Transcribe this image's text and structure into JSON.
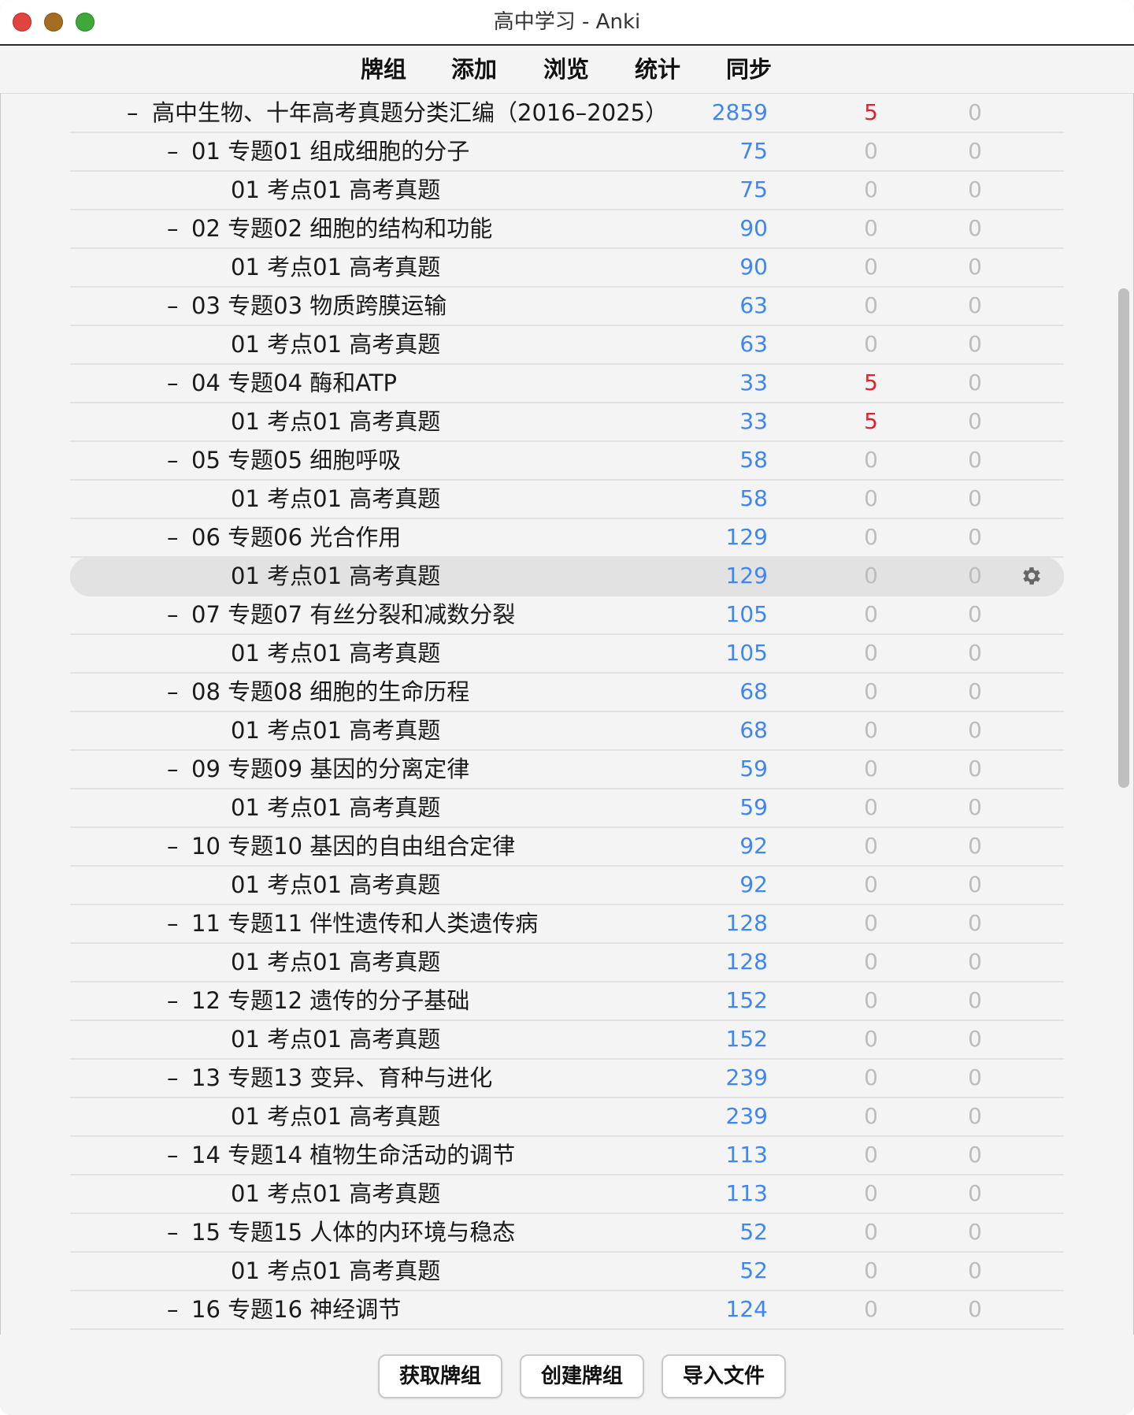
{
  "window": {
    "title": "高中学习 - Anki"
  },
  "toolbar": {
    "decks": "牌组",
    "add": "添加",
    "browse": "浏览",
    "stats": "统计",
    "sync": "同步"
  },
  "colors": {
    "new": "#3f86ef",
    "learn": "#e0212e",
    "zero": "#bdbdbd",
    "selected_row": "#e2e2e2"
  },
  "decks": [
    {
      "collapse": "–",
      "name": "高中生物、十年高考真题分类汇编（2016–2025）",
      "new": "2859",
      "learn": "5",
      "due": "0",
      "level": 0
    },
    {
      "collapse": "–",
      "name": "01 专题01 组成细胞的分子",
      "new": "75",
      "learn": "0",
      "due": "0",
      "level": 1
    },
    {
      "collapse": "",
      "name": "01 考点01 高考真题",
      "new": "75",
      "learn": "0",
      "due": "0",
      "level": 2
    },
    {
      "collapse": "–",
      "name": "02 专题02 细胞的结构和功能",
      "new": "90",
      "learn": "0",
      "due": "0",
      "level": 1
    },
    {
      "collapse": "",
      "name": "01 考点01 高考真题",
      "new": "90",
      "learn": "0",
      "due": "0",
      "level": 2
    },
    {
      "collapse": "–",
      "name": "03 专题03 物质跨膜运输",
      "new": "63",
      "learn": "0",
      "due": "0",
      "level": 1
    },
    {
      "collapse": "",
      "name": "01 考点01 高考真题",
      "new": "63",
      "learn": "0",
      "due": "0",
      "level": 2
    },
    {
      "collapse": "–",
      "name": "04 专题04 酶和ATP",
      "new": "33",
      "learn": "5",
      "due": "0",
      "level": 1
    },
    {
      "collapse": "",
      "name": "01 考点01 高考真题",
      "new": "33",
      "learn": "5",
      "due": "0",
      "level": 2
    },
    {
      "collapse": "–",
      "name": "05 专题05 细胞呼吸",
      "new": "58",
      "learn": "0",
      "due": "0",
      "level": 1
    },
    {
      "collapse": "",
      "name": "01 考点01 高考真题",
      "new": "58",
      "learn": "0",
      "due": "0",
      "level": 2
    },
    {
      "collapse": "–",
      "name": "06 专题06 光合作用",
      "new": "129",
      "learn": "0",
      "due": "0",
      "level": 1
    },
    {
      "collapse": "",
      "name": "01 考点01 高考真题",
      "new": "129",
      "learn": "0",
      "due": "0",
      "level": 2,
      "selected": true
    },
    {
      "collapse": "–",
      "name": "07 专题07 有丝分裂和减数分裂",
      "new": "105",
      "learn": "0",
      "due": "0",
      "level": 1
    },
    {
      "collapse": "",
      "name": "01 考点01 高考真题",
      "new": "105",
      "learn": "0",
      "due": "0",
      "level": 2
    },
    {
      "collapse": "–",
      "name": "08 专题08 细胞的生命历程",
      "new": "68",
      "learn": "0",
      "due": "0",
      "level": 1
    },
    {
      "collapse": "",
      "name": "01 考点01 高考真题",
      "new": "68",
      "learn": "0",
      "due": "0",
      "level": 2
    },
    {
      "collapse": "–",
      "name": "09 专题09 基因的分离定律",
      "new": "59",
      "learn": "0",
      "due": "0",
      "level": 1
    },
    {
      "collapse": "",
      "name": "01 考点01 高考真题",
      "new": "59",
      "learn": "0",
      "due": "0",
      "level": 2
    },
    {
      "collapse": "–",
      "name": "10 专题10 基因的自由组合定律",
      "new": "92",
      "learn": "0",
      "due": "0",
      "level": 1
    },
    {
      "collapse": "",
      "name": "01 考点01 高考真题",
      "new": "92",
      "learn": "0",
      "due": "0",
      "level": 2
    },
    {
      "collapse": "–",
      "name": "11 专题11 伴性遗传和人类遗传病",
      "new": "128",
      "learn": "0",
      "due": "0",
      "level": 1
    },
    {
      "collapse": "",
      "name": "01 考点01 高考真题",
      "new": "128",
      "learn": "0",
      "due": "0",
      "level": 2
    },
    {
      "collapse": "–",
      "name": "12 专题12 遗传的分子基础",
      "new": "152",
      "learn": "0",
      "due": "0",
      "level": 1
    },
    {
      "collapse": "",
      "name": "01 考点01 高考真题",
      "new": "152",
      "learn": "0",
      "due": "0",
      "level": 2
    },
    {
      "collapse": "–",
      "name": "13 专题13 变异、育种与进化",
      "new": "239",
      "learn": "0",
      "due": "0",
      "level": 1
    },
    {
      "collapse": "",
      "name": "01 考点01 高考真题",
      "new": "239",
      "learn": "0",
      "due": "0",
      "level": 2
    },
    {
      "collapse": "–",
      "name": "14 专题14 植物生命活动的调节",
      "new": "113",
      "learn": "0",
      "due": "0",
      "level": 1
    },
    {
      "collapse": "",
      "name": "01 考点01 高考真题",
      "new": "113",
      "learn": "0",
      "due": "0",
      "level": 2
    },
    {
      "collapse": "–",
      "name": "15 专题15 人体的内环境与稳态",
      "new": "52",
      "learn": "0",
      "due": "0",
      "level": 1
    },
    {
      "collapse": "",
      "name": "01 考点01 高考真题",
      "new": "52",
      "learn": "0",
      "due": "0",
      "level": 2
    },
    {
      "collapse": "–",
      "name": "16 专题16 神经调节",
      "new": "124",
      "learn": "0",
      "due": "0",
      "level": 1
    }
  ],
  "buttons": {
    "get_shared": "获取牌组",
    "create_deck": "创建牌组",
    "import_file": "导入文件"
  },
  "icons": {
    "row_options": "gear-icon"
  }
}
